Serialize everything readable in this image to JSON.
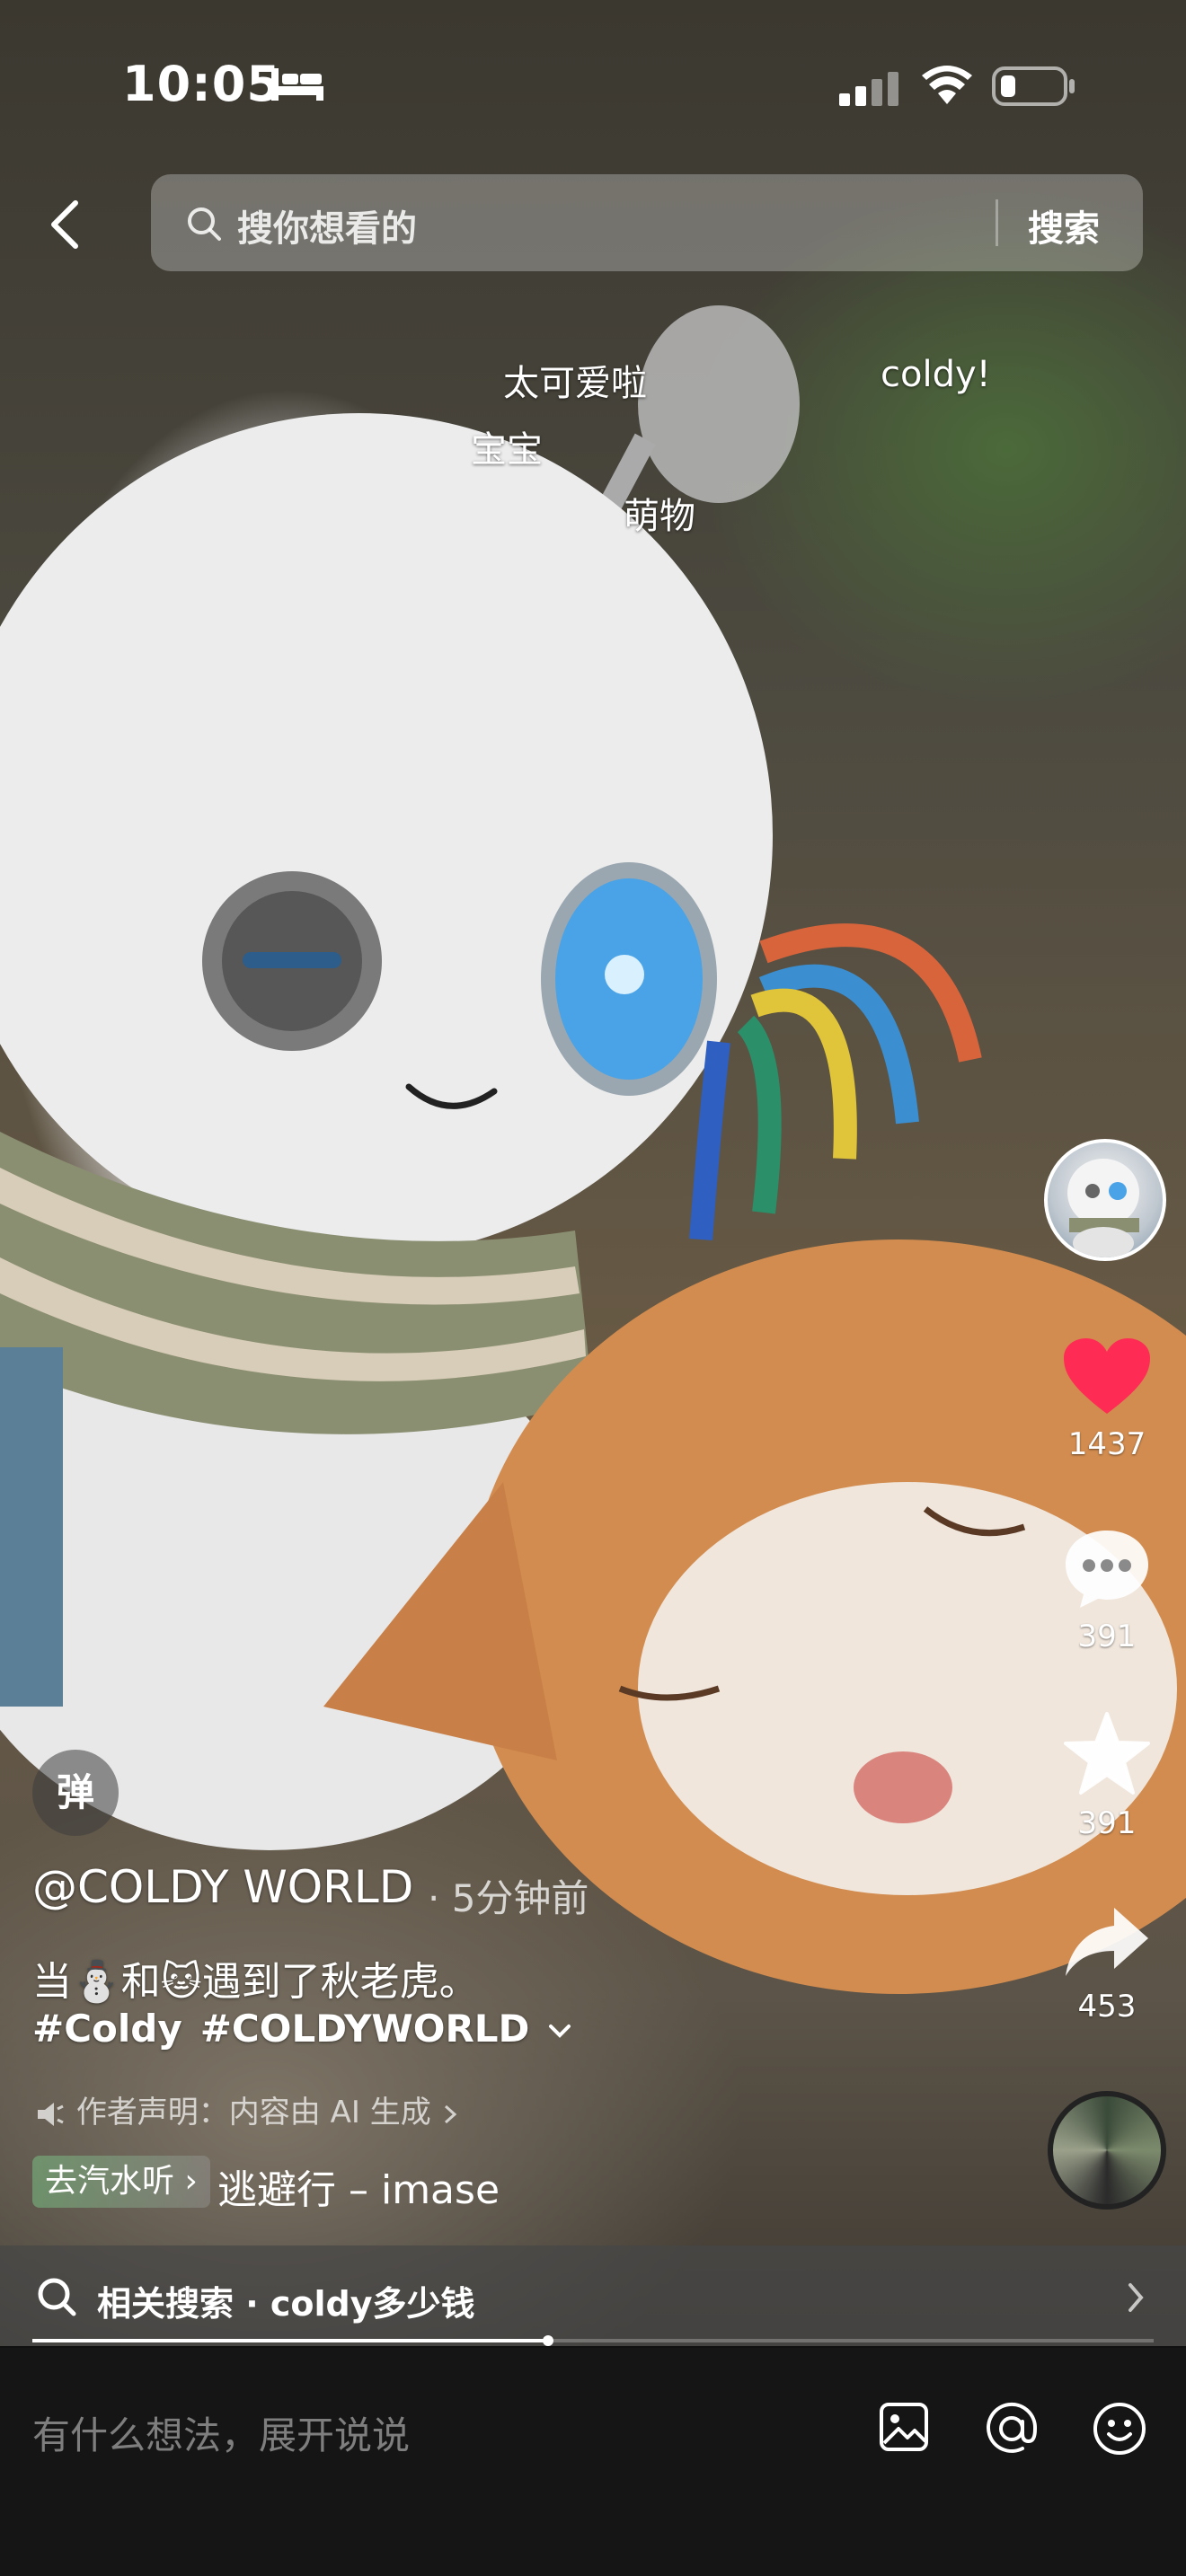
{
  "status_bar": {
    "time": "10:05",
    "sleep_icon": "bed-icon",
    "signal_icon": "cellular-signal-icon",
    "wifi_icon": "wifi-icon",
    "battery_icon": "battery-icon"
  },
  "search": {
    "back_icon": "chevron-left-icon",
    "placeholder": "搜你想看的",
    "button_label": "搜索"
  },
  "danmaku": [
    "太可爱啦",
    "coldy!",
    "宝宝",
    "萌物"
  ],
  "actions": {
    "likes": "1437",
    "comments": "391",
    "favorites": "391",
    "shares": "453",
    "like_color": "#fe2c55"
  },
  "danmaku_toggle_label": "弹",
  "post": {
    "author": "@COLDY WORLD",
    "time": "· 5分钟前",
    "caption": "当⛄和🐱遇到了秋老虎。",
    "hashtags": [
      "#Coldy",
      "#COLDYWORLD"
    ],
    "ai_note": "作者声明：内容由 AI 生成",
    "music_chip": "去汽水听",
    "music_title": "逃避行 – imase"
  },
  "related": {
    "text": "相关搜索 · coldy多少钱",
    "progress": 0.46
  },
  "comment_bar": {
    "placeholder": "有什么想法，展开说说"
  }
}
